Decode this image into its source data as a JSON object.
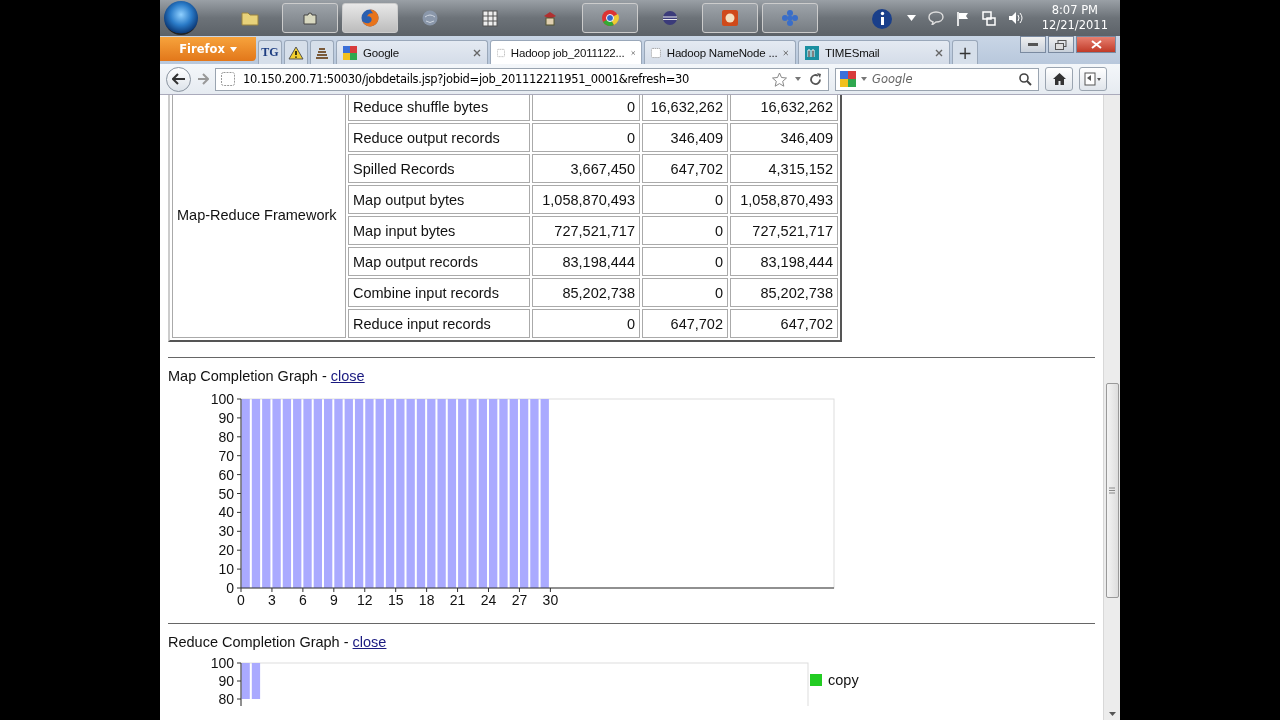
{
  "taskbar": {
    "apps": [
      {
        "kind": "folder",
        "running": false,
        "selected": false
      },
      {
        "kind": "puzzle",
        "running": true,
        "selected": false
      },
      {
        "kind": "firefox",
        "running": true,
        "selected": true
      },
      {
        "kind": "globe",
        "running": false,
        "selected": false
      },
      {
        "kind": "grid",
        "running": false,
        "selected": false
      },
      {
        "kind": "hat",
        "running": false,
        "selected": false
      },
      {
        "kind": "chrome",
        "running": true,
        "selected": false
      },
      {
        "kind": "eclipse",
        "running": false,
        "selected": false
      },
      {
        "kind": "slides",
        "running": true,
        "selected": false
      },
      {
        "kind": "flower",
        "running": true,
        "selected": false
      }
    ],
    "clock": {
      "time": "8:07 PM",
      "date": "12/21/2011"
    }
  },
  "browser": {
    "menu_button": "Firefox",
    "tabs": [
      {
        "kind": "lettered",
        "label": "TG",
        "selected": false
      },
      {
        "kind": "warning",
        "selected": false
      },
      {
        "kind": "stack",
        "selected": false
      },
      {
        "kind": "google",
        "label": "Google",
        "selected": false
      },
      {
        "kind": "blank",
        "label": "Hadoop job_2011122...",
        "selected": true
      },
      {
        "kind": "blank",
        "label": "Hadoop NameNode ...",
        "selected": false
      },
      {
        "kind": "mail",
        "label": "TIMESmail",
        "selected": false
      }
    ],
    "new_tab": "+",
    "url": "10.150.200.71:50030/jobdetails.jsp?jobid=job_201112211951_0001&refresh=30",
    "search": {
      "placeholder": "Google"
    }
  },
  "counters": {
    "group": "Map-Reduce Framework",
    "rows": [
      {
        "name": "Reduce shuffle bytes",
        "map": "0",
        "reduce": "16,632,262",
        "total": "16,632,262"
      },
      {
        "name": "Reduce output records",
        "map": "0",
        "reduce": "346,409",
        "total": "346,409"
      },
      {
        "name": "Spilled Records",
        "map": "3,667,450",
        "reduce": "647,702",
        "total": "4,315,152"
      },
      {
        "name": "Map output bytes",
        "map": "1,058,870,493",
        "reduce": "0",
        "total": "1,058,870,493"
      },
      {
        "name": "Map input bytes",
        "map": "727,521,717",
        "reduce": "0",
        "total": "727,521,717"
      },
      {
        "name": "Map output records",
        "map": "83,198,444",
        "reduce": "0",
        "total": "83,198,444"
      },
      {
        "name": "Combine input records",
        "map": "85,202,738",
        "reduce": "0",
        "total": "85,202,738"
      },
      {
        "name": "Reduce input records",
        "map": "0",
        "reduce": "647,702",
        "total": "647,702"
      }
    ]
  },
  "map_graph": {
    "heading": "Map Completion Graph -",
    "link": "close",
    "chart_data": {
      "type": "bar",
      "x": [
        0.5,
        1.5,
        2.5,
        3.5,
        4.5,
        5.5,
        6.5,
        7.5,
        8.5,
        9.5,
        10.5,
        11.5,
        12.5,
        13.5,
        14.5,
        15.5,
        16.5,
        17.5,
        18.5,
        19.5,
        20.5,
        21.5,
        22.5,
        23.5,
        24.5,
        25.5,
        26.5,
        27.5,
        28.5,
        29.5
      ],
      "series": [
        {
          "color": "#aaaaff",
          "values": [
            100,
            100,
            100,
            100,
            100,
            100,
            100,
            100,
            100,
            100,
            100,
            100,
            100,
            100,
            100,
            100,
            100,
            100,
            100,
            100,
            100,
            100,
            100,
            100,
            100,
            100,
            100,
            100,
            100,
            100
          ]
        }
      ],
      "xlim": [
        0,
        57.5
      ],
      "ylim": [
        0,
        100
      ],
      "xticks": [
        0,
        3,
        6,
        9,
        12,
        15,
        18,
        21,
        24,
        27,
        30
      ],
      "yticks": [
        0,
        10,
        20,
        30,
        40,
        50,
        60,
        70,
        80,
        90,
        100
      ]
    }
  },
  "reduce_graph": {
    "heading": "Reduce Completion Graph -",
    "link": "close",
    "chart_data": {
      "type": "bar",
      "categories": [
        null,
        null
      ],
      "series": [
        {
          "color": "#aaaaff",
          "values": [
            100,
            100
          ]
        }
      ],
      "ylim": [
        80,
        100
      ],
      "yticks": [
        80,
        90,
        100
      ]
    },
    "legend": [
      {
        "label": "copy",
        "color": "#22cc22"
      }
    ]
  }
}
